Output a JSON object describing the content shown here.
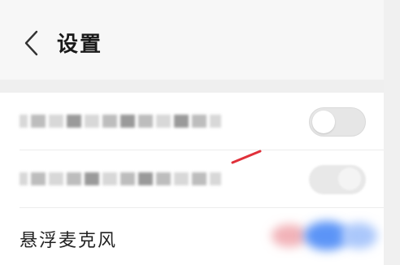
{
  "header": {
    "title": "设置",
    "back_icon": "chevron-left-icon"
  },
  "rows": [
    {
      "label_obscured": true,
      "toggle_state": "off"
    },
    {
      "label_obscured": true,
      "toggle_state": "on"
    },
    {
      "label": "悬浮麦克风",
      "toggle_state": "on"
    }
  ],
  "colors": {
    "toggle_on": "#3d7bf5",
    "toggle_off": "#e6e6e6",
    "annotation_arrow": "#e0303a"
  }
}
